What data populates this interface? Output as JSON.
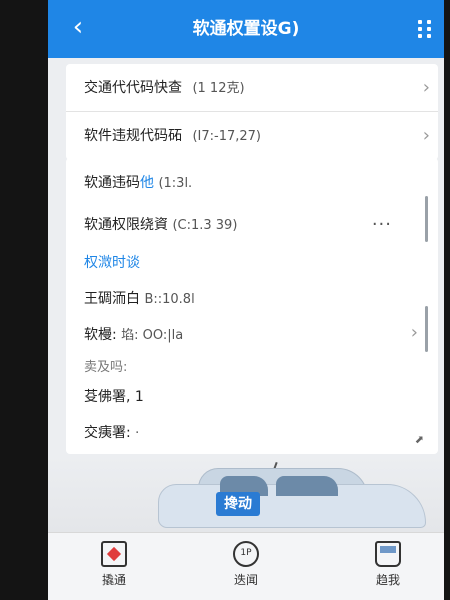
{
  "header": {
    "title": "软通权置设G)",
    "back_icon": "chevron-left-icon",
    "menu_icon": "grid-dots-icon"
  },
  "list": [
    {
      "label": "交通代代码快查",
      "value": "(1 12克)"
    },
    {
      "label": "软件违规代码砳",
      "value": "(I7:-17,27)"
    }
  ],
  "details": {
    "violation_label": "软通违码",
    "violation_link": "他",
    "violation_value": "(1:3l.",
    "limit_label": "软通权限绕資",
    "limit_value": "(C:1.3 39)",
    "more_label": "···",
    "section_link": "权溦时谈",
    "item1_label": "王碉洏白",
    "item1_value": "B::10.8l",
    "item2_label": "软槾:",
    "item2_value": "埳: OO:|la",
    "item3_label": "卖及吗:",
    "item4_label": "芟佛署, 1",
    "item5_label": "交痍署:",
    "item5_value": "·"
  },
  "car": {
    "badge": "搀动"
  },
  "bottom_nav": [
    {
      "label": "撬通",
      "icon": "document-star-icon"
    },
    {
      "label": "迭闻",
      "icon": "badge-icon"
    },
    {
      "label": "趋我",
      "icon": "car-icon"
    }
  ],
  "colors": {
    "accent": "#1f86e6",
    "background": "#eceef1"
  }
}
